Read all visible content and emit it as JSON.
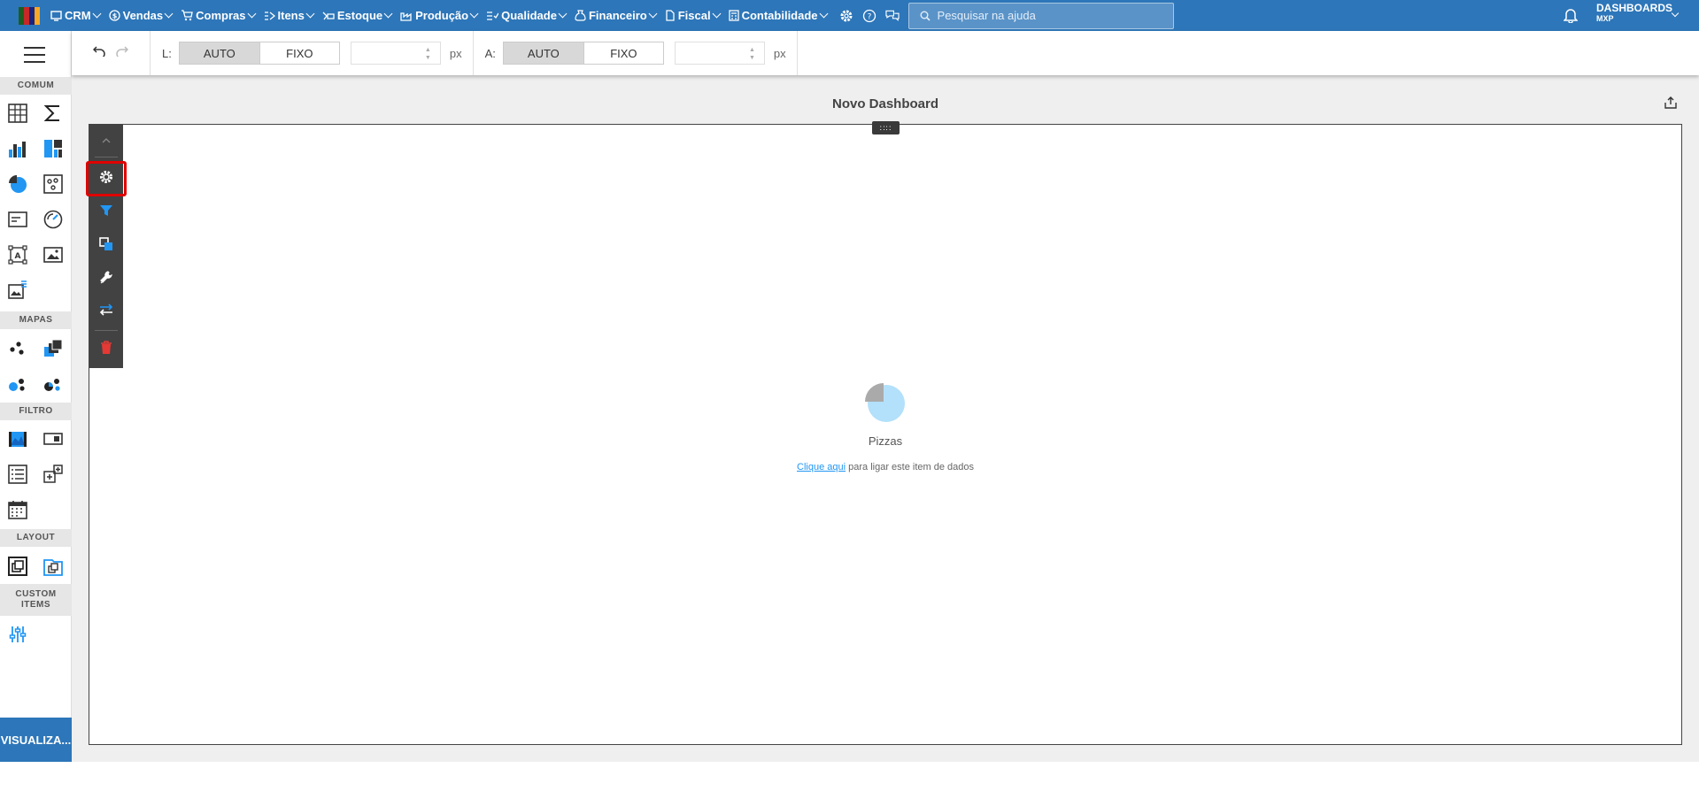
{
  "nav": {
    "items": [
      {
        "label": "CRM",
        "icon": "crm-icon"
      },
      {
        "label": "Vendas",
        "icon": "dollar-icon"
      },
      {
        "label": "Compras",
        "icon": "cart-icon"
      },
      {
        "label": "Itens",
        "icon": "items-icon"
      },
      {
        "label": "Estoque",
        "icon": "truck-icon"
      },
      {
        "label": "Produção",
        "icon": "factory-icon"
      },
      {
        "label": "Qualidade",
        "icon": "quality-icon"
      },
      {
        "label": "Financeiro",
        "icon": "money-bag-icon"
      },
      {
        "label": "Fiscal",
        "icon": "document-icon"
      },
      {
        "label": "Contabilidade",
        "icon": "calculator-icon"
      }
    ],
    "search_placeholder": "Pesquisar na ajuda",
    "user_title": "DASHBOARDS",
    "user_sub": "MXP"
  },
  "sidebar": {
    "sections": {
      "comum": "COMUM",
      "mapas": "MAPAS",
      "filtro": "FILTRO",
      "layout": "LAYOUT",
      "custom": "CUSTOM ITEMS"
    },
    "visualiza_label": "VISUALIZA..."
  },
  "toolbar": {
    "width_label": "L:",
    "height_label": "A:",
    "auto": "AUTO",
    "fixo": "FIXO",
    "unit": "px"
  },
  "dashboard": {
    "title": "Novo Dashboard",
    "item_name": "Pizzas",
    "link_text": "Clique aqui",
    "hint_rest": " para ligar este item de dados"
  },
  "colors": {
    "brand": "#2d76b9",
    "accent": "#2196f3",
    "highlight": "#e00000",
    "delete": "#e53935"
  }
}
